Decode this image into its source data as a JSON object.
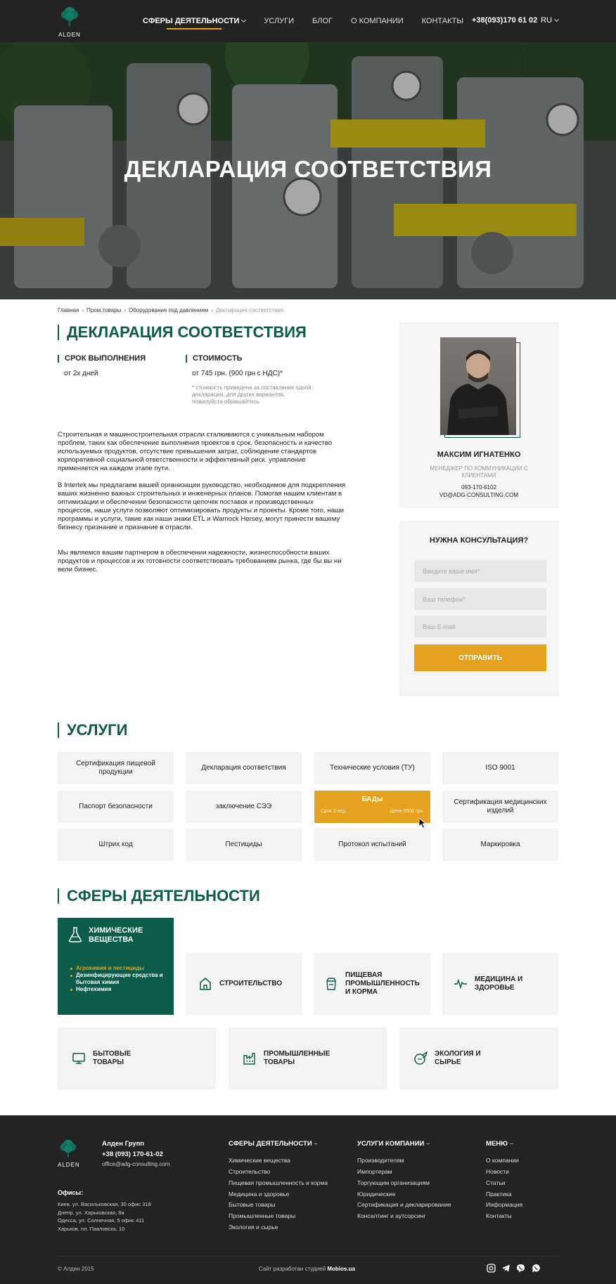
{
  "header": {
    "logo_text": "ALDEN",
    "nav": [
      {
        "label": "СФЕРЫ ДЕЯТЕЛЬНОСТИ",
        "active": true
      },
      {
        "label": "УСЛУГИ"
      },
      {
        "label": "БЛОГ"
      },
      {
        "label": "О КОМПАНИИ"
      },
      {
        "label": "КОНТАКТЫ"
      }
    ],
    "phone": "+38(093)170 61 02",
    "lang": "RU"
  },
  "hero": {
    "title": "ДЕКЛАРАЦИЯ СООТВЕТСТВИЯ"
  },
  "breadcrumb": [
    "Главная",
    "Пром.товары",
    "Оборудование под давлением",
    "Декларация соответствия"
  ],
  "main": {
    "title": "ДЕКЛАРАЦИЯ СООТВЕТСТВИЯ",
    "term_label": "СРОК ВЫПОЛНЕНИЯ",
    "term_value": "от 2х дней",
    "price_label": "СТОИМОСТЬ",
    "price_value": "от 745 грн. (900 грн с НДС)*",
    "price_note": "* стоимость приведена за составление одной декларации, для других вариантов, пожалуйста обращайтесь.",
    "paragraphs": [
      "Строительная и машиностроительная отрасли сталкиваются с уникальным набором проблем, таких как обеспечение выполнения проектов в срок, безопасность и качество используемых продуктов, отсутствие превышения затрат, соблюдение стандартов корпоративной социальной ответственности и эффективный риск. управление применяется на каждом этапе пути.",
      "В Intertek мы предлагаем вашей организации руководство, необходимое для подкрепления ваших жизненно важных строительных и инженерных планов. Помогая нашим клиентам в оптимизации и обеспечении безопасности цепочек поставок и производственных процессов, наши услуги позволяют оптимизировать продукты и проекты. Кроме того, наши программы и услуги, такие как наши знаки ETL и Warnock Hersey, могут принести вашему бизнесу признание и признание в отрасли.",
      "Мы являемся вашим партнером в обеспечении надежности, жизнеспособности ваших продуктов и процессов и их готовности соответствовать требованиям рынка, где бы вы ни вели бизнес."
    ]
  },
  "manager": {
    "name": "МАКСИМ ИГНАТЕНКО",
    "role": "МЕНЕДЖЕР ПО КОММУНИКАЦИИ С КЛИЕНТАМИ",
    "phone": "093-170-6102",
    "email": "VD@ADG-CONSULTING.COM"
  },
  "consult": {
    "title": "НУЖНА КОНСУЛЬТАЦИЯ?",
    "name_placeholder": "Введите ваше имя*",
    "phone_placeholder": "Ваш телефон*",
    "email_placeholder": "Ваш E-mail",
    "submit": "ОТПРАВИТЬ"
  },
  "services": {
    "title": "УСЛУГИ",
    "items": [
      "Сертификация пищевой продукции",
      "Декларация соответствия",
      "Технические условия (ТУ)",
      "ISO 9001",
      "Паспорт безопасности",
      "заключение СЭЭ",
      "БАДы",
      "Сертификация медицинских изделий",
      "Штрих код",
      "Пестициды",
      "Протокол испытаний",
      "Маркировка"
    ],
    "highlight_term": "Срок 2 нед.",
    "highlight_price": "Цена 5600 грн."
  },
  "spheres": {
    "title": "СФЕРЫ ДЕЯТЕЛЬНОСТИ",
    "active": {
      "title": "ХИМИЧЕСКИЕ ВЕЩЕСТВА",
      "items": [
        "Агрохимия и пестициды",
        "Дезинфицирующие средства и бытовая химия",
        "Нефтехимия"
      ]
    },
    "items": [
      {
        "label": "СТРОИТЕЛЬСТВО",
        "icon": "house-icon"
      },
      {
        "label": "ПИЩЕВАЯ ПРОМЫШЛЕННОСТЬ И КОРМА",
        "icon": "food-jar-icon"
      },
      {
        "label": "МЕДИЦИНА И ЗДОРОВЬЕ",
        "icon": "pulse-icon"
      },
      {
        "label": "БЫТОВЫЕ ТОВАРЫ",
        "icon": "monitor-icon"
      },
      {
        "label": "ПРОМЫШЛЕННЫЕ ТОВАРЫ",
        "icon": "factory-icon"
      },
      {
        "label": "ЭКОЛОГИЯ И СЫРЬЕ",
        "icon": "eco-icon"
      }
    ]
  },
  "footer": {
    "logo_text": "ALDEN",
    "company": "Алден Групп",
    "phone": "+38 (093) 170-61-02",
    "email": "office@adg-consulting.com",
    "offices_label": "Офисы:",
    "offices": [
      "Киев, ул. Васильковская, 30 офис 318",
      "Днепр, ул. Харьковская, 8а",
      "Одесса, ул. Солнечная, 5 офис 411",
      "Харьков, пл. Павловска, 10"
    ],
    "col1_title": "СФЕРЫ ДЕЯТЕЛЬНОСТИ",
    "col1": [
      "Химические вещества",
      "Строительство",
      "Пищевая промышленность и корма",
      "Медицина и здоровье",
      "Бытовые товары",
      "Промышленные товары",
      "Экология и сырье"
    ],
    "col2_title": "УСЛУГИ КОМПАНИИ",
    "col2": [
      "Производителям",
      "Импортерам",
      "Торгующим организациям",
      "Юридические",
      "Сертификация и декларирование",
      "Консалтинг и аутсорсинг"
    ],
    "col3_title": "МЕНЮ",
    "col3": [
      "О компании",
      "Новости",
      "Статьи",
      "Практика",
      "Информация",
      "Контакты"
    ],
    "copyright": "© Алден 2015",
    "dev_prefix": "Сайт разработан студией",
    "dev_name": "Mobios.ua",
    "dash": "–"
  },
  "colors": {
    "brand": "#0b5c48",
    "accent": "#e5a21f",
    "dark": "#232323"
  }
}
